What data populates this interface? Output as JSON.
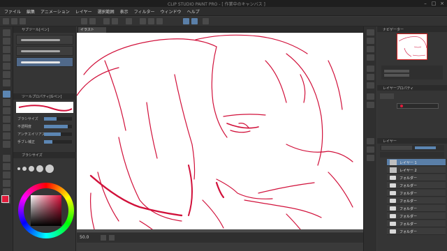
{
  "window": {
    "title": "CLIP STUDIO PAINT PRO - [ 作業中のキャンバス ]",
    "controls": [
      "–",
      "□",
      "×"
    ]
  },
  "menu": [
    {
      "label": "ファイル"
    },
    {
      "label": "編集"
    },
    {
      "label": "アニメーション"
    },
    {
      "label": "レイヤー"
    },
    {
      "label": "選択範囲"
    },
    {
      "label": "表示"
    },
    {
      "label": "フィルター"
    },
    {
      "label": "ウィンドウ"
    },
    {
      "label": "ヘルプ"
    }
  ],
  "sub_tool": {
    "header": "サブツール[ペン]",
    "brushes": [
      {
        "name": ""
      },
      {
        "name": ""
      },
      {
        "name": ""
      }
    ],
    "selected_brush_index": 2,
    "tool_property_header": "ツールプロパティ[Gペン]",
    "properties": [
      {
        "label": "ブラシサイズ",
        "level": 0.45
      },
      {
        "label": "不透明度",
        "level": 0.85
      },
      {
        "label": "アンチエイリアス",
        "level": 0.6
      },
      {
        "label": "手ブレ補正",
        "level": 0.3
      }
    ],
    "brush_size_header": "ブラシサイズ"
  },
  "color": {
    "main": "#e31b3b",
    "sub": "#ffffff",
    "line_color": "#d1103a"
  },
  "canvas": {
    "tab_label": "イラスト",
    "zoom": "50.0"
  },
  "navigator": {
    "header": "ナビゲーター"
  },
  "layer_property": {
    "header": "レイヤープロパティ"
  },
  "layers": {
    "header": "レイヤー",
    "items": [
      {
        "name": "レイヤー 1",
        "type": "raster",
        "selected": true
      },
      {
        "name": "レイヤー 2",
        "type": "raster",
        "selected": false
      },
      {
        "name": "フォルダー",
        "type": "folder",
        "selected": false
      },
      {
        "name": "フォルダー",
        "type": "folder",
        "selected": false
      },
      {
        "name": "フォルダー",
        "type": "folder",
        "selected": false
      },
      {
        "name": "フォルダー",
        "type": "folder",
        "selected": false
      },
      {
        "name": "フォルダー",
        "type": "folder",
        "selected": false
      },
      {
        "name": "フォルダー",
        "type": "folder",
        "selected": false
      },
      {
        "name": "フォルダー",
        "type": "folder",
        "selected": false
      },
      {
        "name": "フォルダー",
        "type": "folder",
        "selected": false
      }
    ]
  }
}
